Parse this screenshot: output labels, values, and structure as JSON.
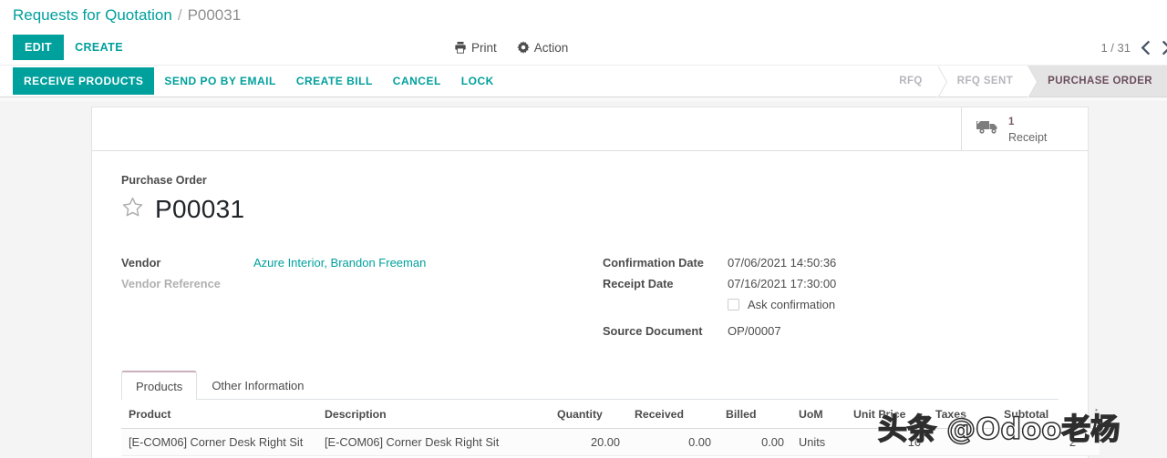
{
  "breadcrumb": {
    "parent": "Requests for Quotation",
    "separator": "/",
    "current": "P00031"
  },
  "control_panel": {
    "edit_label": "EDIT",
    "create_label": "CREATE",
    "print_label": "Print",
    "action_label": "Action",
    "pager": "1 / 31",
    "prev_icon": "chevron-left-icon",
    "next_icon": "chevron-right-icon"
  },
  "statusbar": {
    "buttons": [
      {
        "label": "RECEIVE PRODUCTS",
        "primary": true
      },
      {
        "label": "SEND PO BY EMAIL",
        "primary": false
      },
      {
        "label": "CREATE BILL",
        "primary": false
      },
      {
        "label": "CANCEL",
        "primary": false
      },
      {
        "label": "LOCK",
        "primary": false
      }
    ],
    "stages": [
      {
        "label": "RFQ",
        "active": false
      },
      {
        "label": "RFQ SENT",
        "active": false
      },
      {
        "label": "PURCHASE ORDER",
        "active": true
      }
    ]
  },
  "smart_buttons": [
    {
      "icon": "truck-icon",
      "value": "1",
      "label": "Receipt"
    }
  ],
  "form": {
    "title_label": "Purchase Order",
    "title": "P00031",
    "favorite_icon": "star-outline-icon",
    "left_fields": [
      {
        "label": "Vendor",
        "value": "Azure Interior, Brandon Freeman",
        "link": true,
        "muted_label": false
      },
      {
        "label": "Vendor Reference",
        "value": "",
        "link": false,
        "muted_label": true
      }
    ],
    "right_fields": [
      {
        "label": "Confirmation Date",
        "value": "07/06/2021 14:50:36"
      },
      {
        "label": "Receipt Date",
        "value": "07/16/2021 17:30:00"
      },
      {
        "label": "Source Document",
        "value": "OP/00007"
      }
    ],
    "checkbox": {
      "label": "Ask confirmation",
      "checked": false
    }
  },
  "notebook": {
    "tabs": [
      {
        "label": "Products",
        "active": true
      },
      {
        "label": "Other Information",
        "active": false
      }
    ]
  },
  "lines_table": {
    "columns": [
      "Product",
      "Description",
      "Quantity",
      "Received",
      "Billed",
      "UoM",
      "Unit Price",
      "Taxes",
      "Subtotal"
    ],
    "optional_columns_icon": "vertical-dots-icon",
    "rows": [
      {
        "product": "[E-COM06] Corner Desk Right Sit",
        "description": "[E-COM06] Corner Desk Right Sit",
        "quantity": "20.00",
        "received": "0.00",
        "billed": "0.00",
        "uom": "Units",
        "unit_price": "16",
        "taxes": "",
        "subtotal": "2"
      }
    ]
  },
  "watermark": {
    "text": "头条 @Odoo老杨"
  },
  "colors": {
    "accent": "#00a09d",
    "stage_active_bg": "#e4e4e4",
    "stage_active_text": "#6b4e5c",
    "page_bg": "#f4f4f4"
  }
}
